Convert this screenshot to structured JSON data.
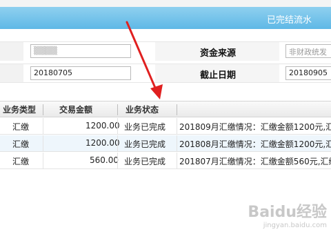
{
  "header": {
    "title": "已完结流水"
  },
  "form": {
    "fund_source_label": "资金来源",
    "fund_source_placeholder": "非财政统发",
    "start_date_value": "20180705",
    "end_date_label": "截止日期",
    "end_date_value": "20180905"
  },
  "table": {
    "columns": [
      "业务类型",
      "交易金额",
      "业务状态"
    ],
    "rows": [
      {
        "type": "汇缴",
        "amount": "1200.00",
        "status": "业务已完成",
        "desc": "201809月汇缴情况：汇缴金额1200元,汇"
      },
      {
        "type": "汇缴",
        "amount": "1200.00",
        "status": "业务已完成",
        "desc": "201808月汇缴情况：汇缴金额1200元,汇"
      },
      {
        "type": "汇缴",
        "amount": "560.00",
        "status": "业务已完成",
        "desc": "201807月汇缴情况：汇缴金额560元,汇缴"
      }
    ]
  },
  "watermark": {
    "text": "Baidu经验",
    "sub": "jingyan.baidu.com"
  },
  "colors": {
    "title_bar": "#6cc0ea",
    "alt_row": "#eef6fc",
    "arrow": "#e02020"
  }
}
